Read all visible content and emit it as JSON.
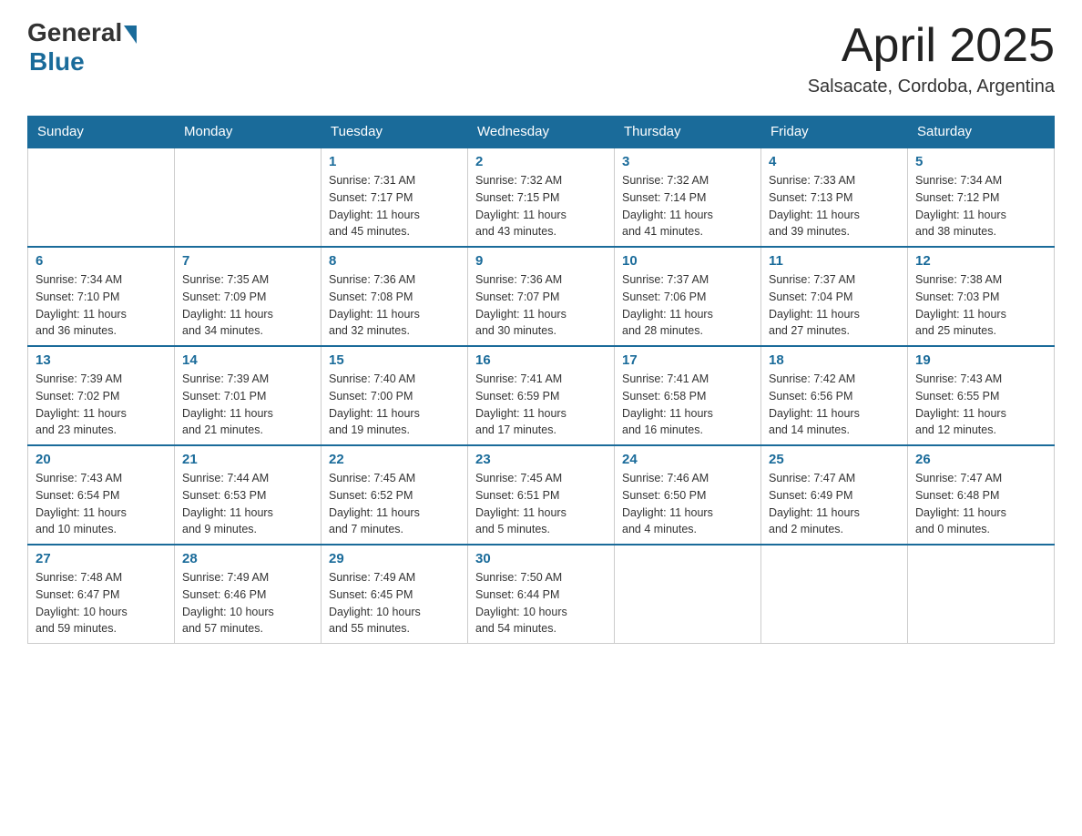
{
  "header": {
    "logo_general": "General",
    "logo_blue": "Blue",
    "month_title": "April 2025",
    "location": "Salsacate, Cordoba, Argentina"
  },
  "calendar": {
    "days_of_week": [
      "Sunday",
      "Monday",
      "Tuesday",
      "Wednesday",
      "Thursday",
      "Friday",
      "Saturday"
    ],
    "weeks": [
      [
        {
          "day": "",
          "info": ""
        },
        {
          "day": "",
          "info": ""
        },
        {
          "day": "1",
          "info": "Sunrise: 7:31 AM\nSunset: 7:17 PM\nDaylight: 11 hours\nand 45 minutes."
        },
        {
          "day": "2",
          "info": "Sunrise: 7:32 AM\nSunset: 7:15 PM\nDaylight: 11 hours\nand 43 minutes."
        },
        {
          "day": "3",
          "info": "Sunrise: 7:32 AM\nSunset: 7:14 PM\nDaylight: 11 hours\nand 41 minutes."
        },
        {
          "day": "4",
          "info": "Sunrise: 7:33 AM\nSunset: 7:13 PM\nDaylight: 11 hours\nand 39 minutes."
        },
        {
          "day": "5",
          "info": "Sunrise: 7:34 AM\nSunset: 7:12 PM\nDaylight: 11 hours\nand 38 minutes."
        }
      ],
      [
        {
          "day": "6",
          "info": "Sunrise: 7:34 AM\nSunset: 7:10 PM\nDaylight: 11 hours\nand 36 minutes."
        },
        {
          "day": "7",
          "info": "Sunrise: 7:35 AM\nSunset: 7:09 PM\nDaylight: 11 hours\nand 34 minutes."
        },
        {
          "day": "8",
          "info": "Sunrise: 7:36 AM\nSunset: 7:08 PM\nDaylight: 11 hours\nand 32 minutes."
        },
        {
          "day": "9",
          "info": "Sunrise: 7:36 AM\nSunset: 7:07 PM\nDaylight: 11 hours\nand 30 minutes."
        },
        {
          "day": "10",
          "info": "Sunrise: 7:37 AM\nSunset: 7:06 PM\nDaylight: 11 hours\nand 28 minutes."
        },
        {
          "day": "11",
          "info": "Sunrise: 7:37 AM\nSunset: 7:04 PM\nDaylight: 11 hours\nand 27 minutes."
        },
        {
          "day": "12",
          "info": "Sunrise: 7:38 AM\nSunset: 7:03 PM\nDaylight: 11 hours\nand 25 minutes."
        }
      ],
      [
        {
          "day": "13",
          "info": "Sunrise: 7:39 AM\nSunset: 7:02 PM\nDaylight: 11 hours\nand 23 minutes."
        },
        {
          "day": "14",
          "info": "Sunrise: 7:39 AM\nSunset: 7:01 PM\nDaylight: 11 hours\nand 21 minutes."
        },
        {
          "day": "15",
          "info": "Sunrise: 7:40 AM\nSunset: 7:00 PM\nDaylight: 11 hours\nand 19 minutes."
        },
        {
          "day": "16",
          "info": "Sunrise: 7:41 AM\nSunset: 6:59 PM\nDaylight: 11 hours\nand 17 minutes."
        },
        {
          "day": "17",
          "info": "Sunrise: 7:41 AM\nSunset: 6:58 PM\nDaylight: 11 hours\nand 16 minutes."
        },
        {
          "day": "18",
          "info": "Sunrise: 7:42 AM\nSunset: 6:56 PM\nDaylight: 11 hours\nand 14 minutes."
        },
        {
          "day": "19",
          "info": "Sunrise: 7:43 AM\nSunset: 6:55 PM\nDaylight: 11 hours\nand 12 minutes."
        }
      ],
      [
        {
          "day": "20",
          "info": "Sunrise: 7:43 AM\nSunset: 6:54 PM\nDaylight: 11 hours\nand 10 minutes."
        },
        {
          "day": "21",
          "info": "Sunrise: 7:44 AM\nSunset: 6:53 PM\nDaylight: 11 hours\nand 9 minutes."
        },
        {
          "day": "22",
          "info": "Sunrise: 7:45 AM\nSunset: 6:52 PM\nDaylight: 11 hours\nand 7 minutes."
        },
        {
          "day": "23",
          "info": "Sunrise: 7:45 AM\nSunset: 6:51 PM\nDaylight: 11 hours\nand 5 minutes."
        },
        {
          "day": "24",
          "info": "Sunrise: 7:46 AM\nSunset: 6:50 PM\nDaylight: 11 hours\nand 4 minutes."
        },
        {
          "day": "25",
          "info": "Sunrise: 7:47 AM\nSunset: 6:49 PM\nDaylight: 11 hours\nand 2 minutes."
        },
        {
          "day": "26",
          "info": "Sunrise: 7:47 AM\nSunset: 6:48 PM\nDaylight: 11 hours\nand 0 minutes."
        }
      ],
      [
        {
          "day": "27",
          "info": "Sunrise: 7:48 AM\nSunset: 6:47 PM\nDaylight: 10 hours\nand 59 minutes."
        },
        {
          "day": "28",
          "info": "Sunrise: 7:49 AM\nSunset: 6:46 PM\nDaylight: 10 hours\nand 57 minutes."
        },
        {
          "day": "29",
          "info": "Sunrise: 7:49 AM\nSunset: 6:45 PM\nDaylight: 10 hours\nand 55 minutes."
        },
        {
          "day": "30",
          "info": "Sunrise: 7:50 AM\nSunset: 6:44 PM\nDaylight: 10 hours\nand 54 minutes."
        },
        {
          "day": "",
          "info": ""
        },
        {
          "day": "",
          "info": ""
        },
        {
          "day": "",
          "info": ""
        }
      ]
    ]
  }
}
